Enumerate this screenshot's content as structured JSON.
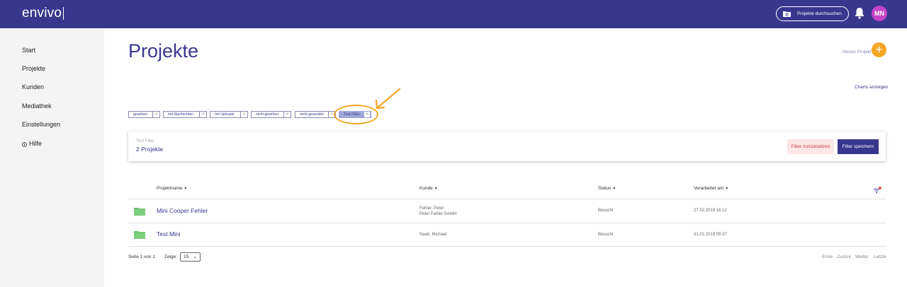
{
  "header": {
    "logo": "envivo",
    "search_label": "Projekte durchsuchen",
    "avatar_initials": "MN",
    "bar_color": "#38378e",
    "avatar_color": "#c544c7"
  },
  "sidebar": {
    "items": [
      {
        "label": "Start"
      },
      {
        "label": "Projekte"
      },
      {
        "label": "Kunden"
      },
      {
        "label": "Mediathek"
      },
      {
        "label": "Einstellungen"
      },
      {
        "label": "Hilfe",
        "icon": "info-icon"
      }
    ]
  },
  "main": {
    "title": "Projekte",
    "new_project_label": "Neues Projekt",
    "charts_link": "Charts anzeigen",
    "accent_color": "#f5a623"
  },
  "chips": [
    {
      "label": "gesehen"
    },
    {
      "label": "mit Nachrichten"
    },
    {
      "label": "mit Uploads"
    },
    {
      "label": "nicht gesehen"
    },
    {
      "label": "nicht gesendet"
    },
    {
      "label": "Test Filter",
      "active": true
    }
  ],
  "filter_card": {
    "name": "Test Filter",
    "count": "2 Projekte",
    "reset_label": "Filter zurücksetzen",
    "save_label": "Filter speichern"
  },
  "table": {
    "columns": [
      "Projektname",
      "Kunde",
      "Status",
      "Verarbeitet am"
    ],
    "rows": [
      {
        "name": "Mini Cooper Fehler",
        "customer_line1": "Fehler, Peter",
        "customer_line2": "Peter Fehler GmbH",
        "status": "Besucht",
        "date": "27.02.2019 16:12"
      },
      {
        "name": "Test Mini",
        "customer_line1": "Naab, Michael",
        "customer_line2": "",
        "status": "Besucht",
        "date": "31.01.2019 09:37"
      }
    ]
  },
  "pagination": {
    "page_info": "Seite 1 von 1",
    "show_label": "Zeige:",
    "page_size": "15",
    "first": "Erste",
    "prev": "Zurück",
    "next": "Weiter",
    "last": "Letzte"
  }
}
